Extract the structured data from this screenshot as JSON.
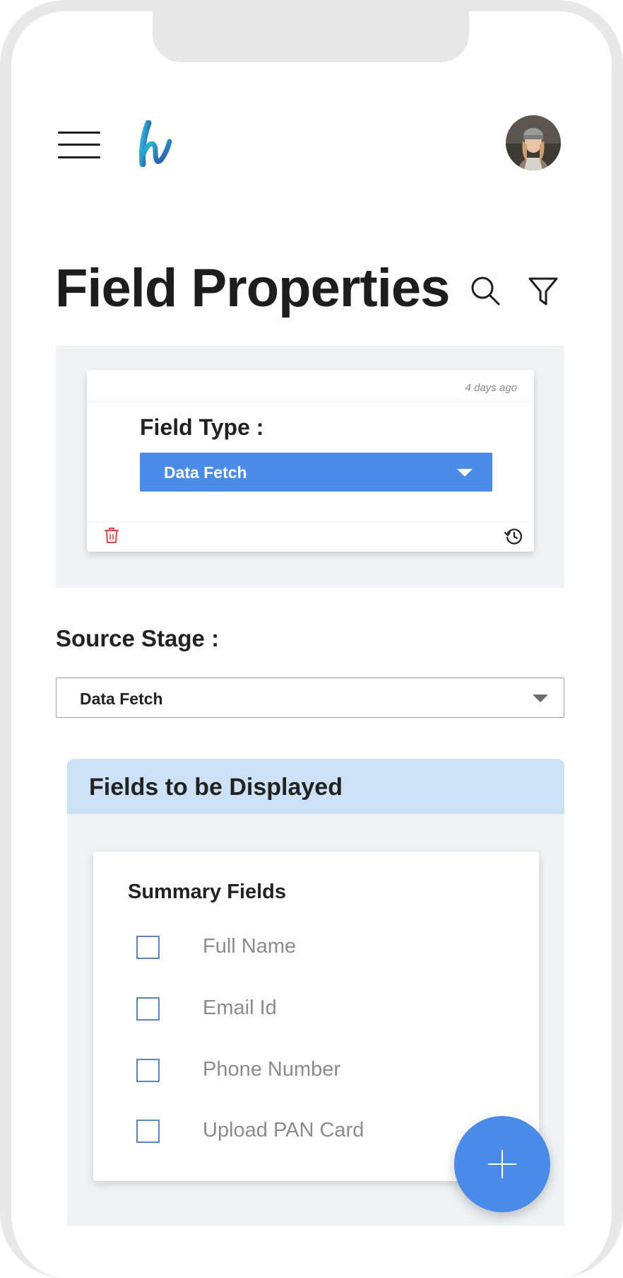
{
  "header": {
    "menu_icon": "hamburger-menu-icon",
    "logo_icon": "brand-logo-icon",
    "avatar_icon": "user-avatar"
  },
  "title": {
    "text": "Field Properties",
    "search_icon": "search-icon",
    "filter_icon": "filter-icon"
  },
  "field_type_card": {
    "timestamp": "4 days ago",
    "label": "Field Type :",
    "selected_value": "Data Fetch",
    "delete_icon": "trash-icon",
    "history_icon": "history-icon"
  },
  "source_stage": {
    "label": "Source Stage :",
    "selected_value": "Data Fetch"
  },
  "fields_panel": {
    "header": "Fields to be Displayed",
    "summary": {
      "title": "Summary Fields",
      "items": [
        {
          "label": "Full Name",
          "checked": false
        },
        {
          "label": "Email Id",
          "checked": false
        },
        {
          "label": "Phone Number",
          "checked": false
        },
        {
          "label": "Upload PAN Card",
          "checked": false
        }
      ]
    }
  },
  "fab": {
    "icon": "plus-icon"
  },
  "colors": {
    "accent": "#4a8be8",
    "panel_bg": "#f1f2f4",
    "section_header_bg": "#cde1f6",
    "delete_red": "#e04848"
  }
}
